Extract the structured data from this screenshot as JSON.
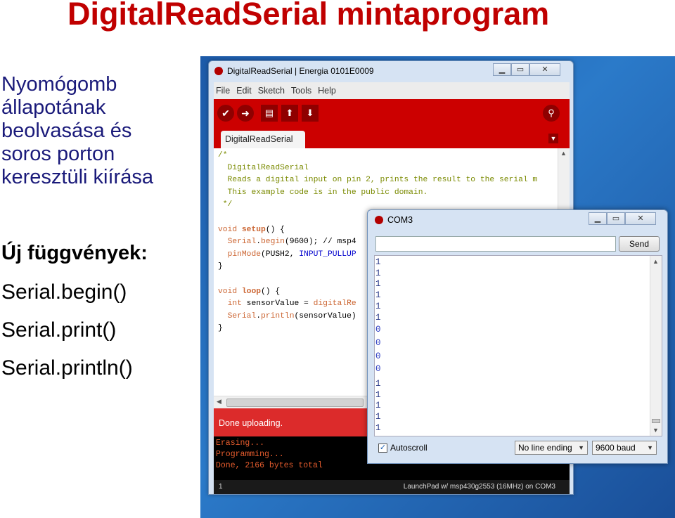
{
  "slide": {
    "title": "DigitalReadSerial mintaprogram",
    "description_lines": [
      "Nyomógomb",
      "állapotának",
      "beolvasása és",
      "soros porton",
      "keresztüli kiírása"
    ],
    "new_functions_heading": "Új függvények:",
    "functions": [
      "Serial.begin()",
      "Serial.print()",
      "Serial.println()"
    ]
  },
  "ide": {
    "window_title": "DigitalReadSerial | Energia 0101E0009",
    "menu": [
      "File",
      "Edit",
      "Sketch",
      "Tools",
      "Help"
    ],
    "toolbar": {
      "verify_icon": "✔",
      "upload_icon": "➜",
      "new_icon": "▤",
      "open_icon": "⬆",
      "save_icon": "⬇",
      "serial_monitor_icon": "⚲"
    },
    "tab_label": "DigitalReadSerial",
    "code": {
      "l1": "/*",
      "l2": "  DigitalReadSerial",
      "l3": "  Reads a digital input on pin 2, prints the result to the serial m",
      "l4": "",
      "l5": "  This example code is in the public domain.",
      "l6": " */",
      "l7": "",
      "l8a": "void",
      "l8b": " ",
      "l8c": "setup",
      "l8d": "() {",
      "l9a": "  ",
      "l9b": "Serial",
      "l9c": ".",
      "l9d": "begin",
      "l9e": "(9600); // msp4",
      "l10a": "  ",
      "l10b": "pinMode",
      "l10c": "(PUSH2, ",
      "l10d": "INPUT_PULLUP",
      "l11": "}",
      "l12": "",
      "l13a": "void",
      "l13b": " ",
      "l13c": "loop",
      "l13d": "() {",
      "l14a": "  ",
      "l14b": "int",
      "l14c": " sensorValue = ",
      "l14d": "digitalRe",
      "l15a": "  ",
      "l15b": "Serial",
      "l15c": ".",
      "l15d": "println",
      "l15e": "(sensorValue)",
      "l16": "}"
    },
    "status_text": "Done uploading.",
    "console": [
      "Erasing...",
      "Programming...",
      "Done, 2166 bytes total"
    ],
    "footer_line": "1",
    "footer_board": "LaunchPad w/ msp430g2553 (16MHz) on COM3",
    "accent_color": "#cc0000"
  },
  "serial_monitor": {
    "title": "COM3",
    "input_value": "",
    "send_label": "Send",
    "output": [
      "1",
      "1",
      "1",
      "1",
      "1",
      "1",
      "0",
      "0",
      "0",
      "0",
      "1",
      "1",
      "1",
      "1",
      "1"
    ],
    "autoscroll_label": "Autoscroll",
    "autoscroll_checked": true,
    "line_ending": "No line ending",
    "baud": "9600 baud"
  }
}
